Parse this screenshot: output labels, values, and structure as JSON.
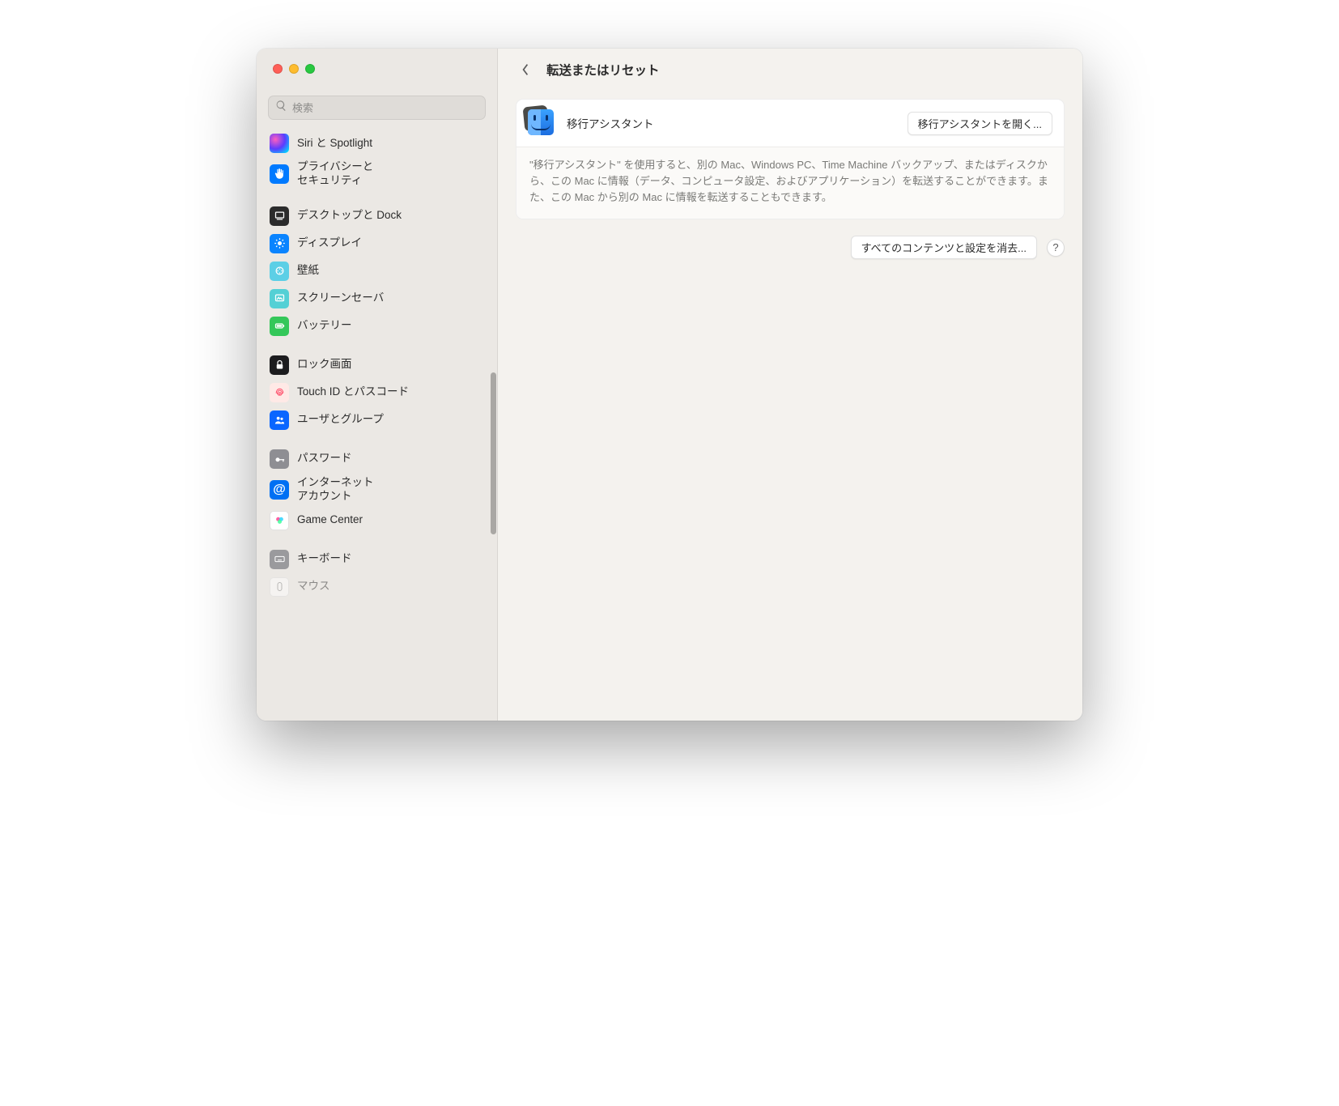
{
  "search": {
    "placeholder": "検索"
  },
  "sidebar": {
    "groups": [
      {
        "items": [
          {
            "label": "Siri と Spotlight",
            "icon_name": "siri-icon"
          },
          {
            "label": "プライバシーと\nセキュリティ",
            "icon_name": "hand-icon"
          }
        ]
      },
      {
        "items": [
          {
            "label": "デスクトップと Dock",
            "icon_name": "dock-icon"
          },
          {
            "label": "ディスプレイ",
            "icon_name": "display-icon"
          },
          {
            "label": "壁紙",
            "icon_name": "wallpaper-icon"
          },
          {
            "label": "スクリーンセーバ",
            "icon_name": "screensaver-icon"
          },
          {
            "label": "バッテリー",
            "icon_name": "battery-icon"
          }
        ]
      },
      {
        "items": [
          {
            "label": "ロック画面",
            "icon_name": "lock-icon"
          },
          {
            "label": "Touch ID とパスコード",
            "icon_name": "touchid-icon"
          },
          {
            "label": "ユーザとグループ",
            "icon_name": "users-icon"
          }
        ]
      },
      {
        "items": [
          {
            "label": "パスワード",
            "icon_name": "key-icon"
          },
          {
            "label": "インターネット\nアカウント",
            "icon_name": "at-icon"
          },
          {
            "label": "Game Center",
            "icon_name": "gamecenter-icon"
          }
        ]
      },
      {
        "items": [
          {
            "label": "キーボード",
            "icon_name": "keyboard-icon"
          },
          {
            "label": "マウス",
            "icon_name": "mouse-icon"
          }
        ]
      }
    ]
  },
  "header": {
    "title": "転送またはリセット"
  },
  "migration": {
    "title": "移行アシスタント",
    "open_button": "移行アシスタントを開く...",
    "description": "\"移行アシスタント\" を使用すると、別の Mac、Windows PC、Time Machine バックアップ、またはディスクから、この Mac に情報（データ、コンピュータ設定、およびアプリケーション）を転送することができます。また、この Mac から別の Mac に情報を転送することもできます。"
  },
  "erase": {
    "button": "すべてのコンテンツと設定を消去...",
    "help": "?"
  }
}
